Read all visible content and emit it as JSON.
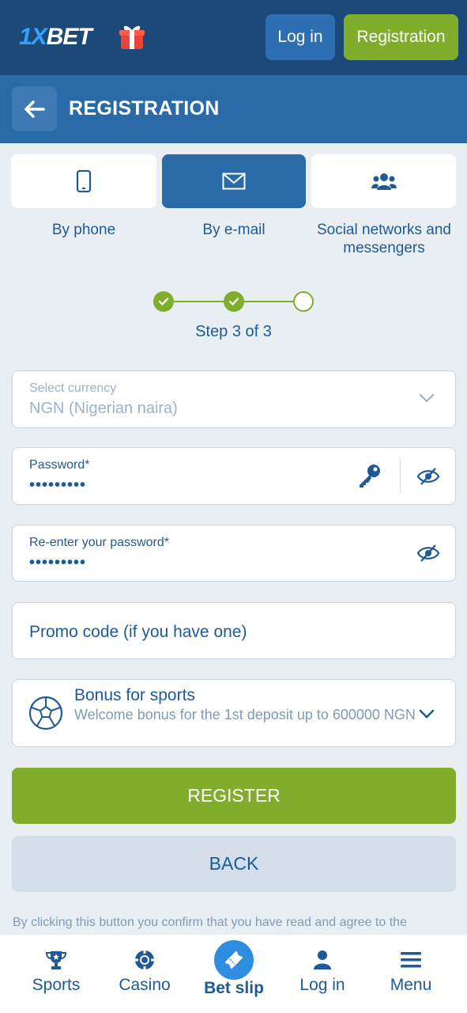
{
  "topbar": {
    "logo_prefix": "1X",
    "logo_suffix": "BET",
    "login_label": "Log in",
    "registration_label": "Registration"
  },
  "header": {
    "title": "REGISTRATION"
  },
  "tabs": [
    {
      "label": "By phone",
      "icon": "phone-icon",
      "active": false
    },
    {
      "label": "By e-mail",
      "icon": "envelope-icon",
      "active": true
    },
    {
      "label": "Social networks and messengers",
      "icon": "users-icon",
      "active": false
    }
  ],
  "stepper": {
    "text": "Step 3 of 3",
    "current": 3,
    "total": 3
  },
  "form": {
    "currency": {
      "label": "Select currency",
      "value": "NGN  (Nigerian naira)"
    },
    "password": {
      "label": "Password*",
      "value": "•••••••••"
    },
    "password_repeat": {
      "label": "Re-enter your password*",
      "value": "•••••••••"
    },
    "promo": {
      "placeholder": "Promo code (if you have one)"
    },
    "bonus": {
      "title": "Bonus for sports",
      "subtitle": "Welcome bonus for the 1st deposit up to 600000 NGN"
    }
  },
  "actions": {
    "register_label": "REGISTER",
    "back_label": "BACK"
  },
  "disclaimer": "By clicking this button you confirm that you have read and agree to the",
  "bottom_nav": {
    "sports": "Sports",
    "casino": "Casino",
    "betslip": "Bet slip",
    "login": "Log in",
    "menu": "Menu"
  },
  "colors": {
    "brand_dark": "#1c4977",
    "brand": "#2b6aa8",
    "accent_green": "#80ad2c",
    "text_blue": "#1f5a96"
  }
}
